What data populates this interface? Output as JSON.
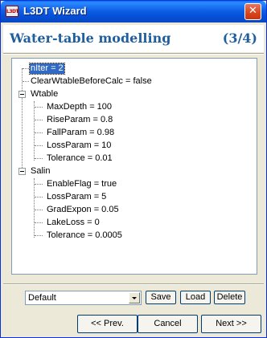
{
  "window": {
    "title": "L3DT Wizard",
    "app_icon_text": "L3DT",
    "close_glyph": "✕"
  },
  "header": {
    "title": "Water-table modelling",
    "step": "(3/4)"
  },
  "tree": {
    "nodes": [
      {
        "label": "nIter = 2",
        "depth": 0,
        "selected": true
      },
      {
        "label": "ClearWtableBeforeCalc = false",
        "depth": 0
      },
      {
        "label": "Wtable",
        "depth": 0,
        "expanded": true
      },
      {
        "label": "MaxDepth = 100",
        "depth": 1
      },
      {
        "label": "RiseParam = 0.8",
        "depth": 1
      },
      {
        "label": "FallParam = 0.98",
        "depth": 1
      },
      {
        "label": "LossParam = 10",
        "depth": 1
      },
      {
        "label": "Tolerance = 0.01",
        "depth": 1
      },
      {
        "label": "Salin",
        "depth": 0,
        "expanded": true
      },
      {
        "label": "EnableFlag = true",
        "depth": 1
      },
      {
        "label": "LossParam = 5",
        "depth": 1
      },
      {
        "label": "GradExpon = 0.05",
        "depth": 1
      },
      {
        "label": "LakeLoss = 0",
        "depth": 1
      },
      {
        "label": "Tolerance = 0.0005",
        "depth": 1
      }
    ]
  },
  "profile": {
    "selected": "Default"
  },
  "buttons": {
    "save": "Save",
    "load": "Load",
    "delete": "Delete",
    "prev": "<< Prev.",
    "cancel": "Cancel",
    "next": "Next >>"
  },
  "colors": {
    "titlebar": "#0550da",
    "header_text": "#1f5fa0",
    "selection": "#316ac5"
  }
}
